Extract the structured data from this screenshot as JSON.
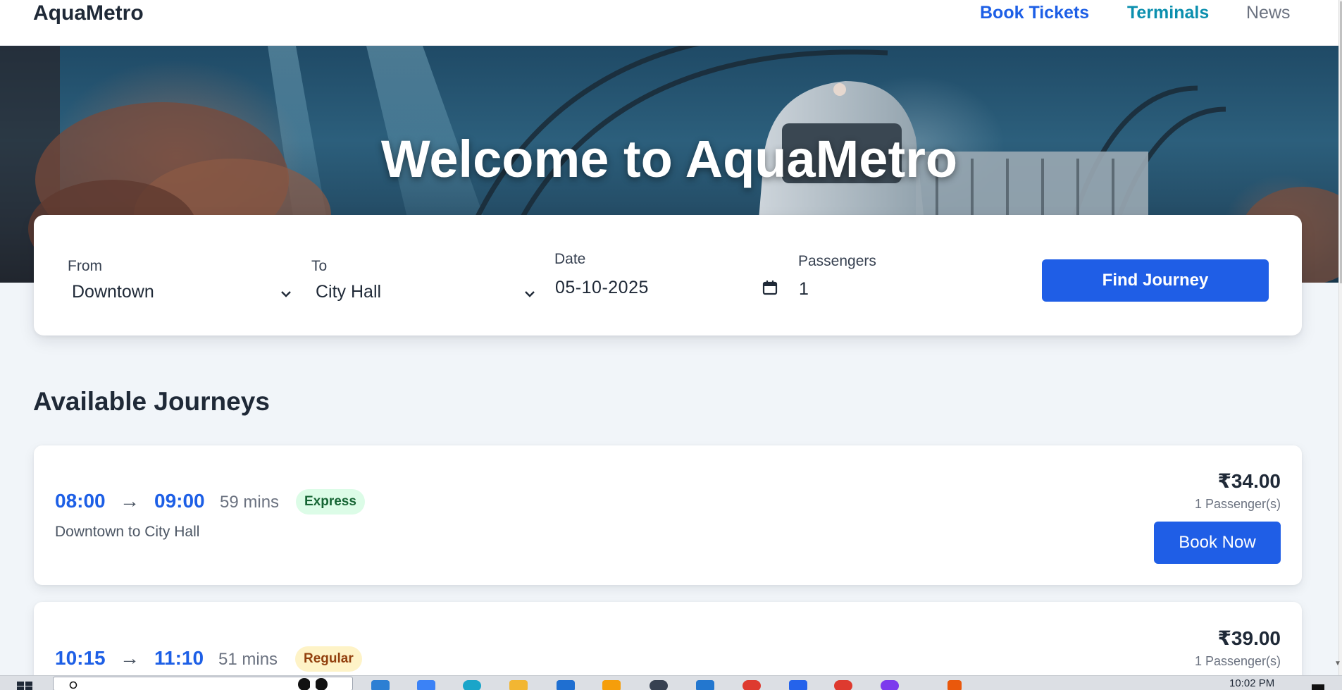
{
  "header": {
    "brand": "AquaMetro",
    "nav": [
      {
        "label": "Book Tickets"
      },
      {
        "label": "Terminals"
      },
      {
        "label": "News"
      }
    ]
  },
  "hero": {
    "title": "Welcome to AquaMetro"
  },
  "search": {
    "from": {
      "label": "From",
      "value": "Downtown"
    },
    "to": {
      "label": "To",
      "value": "City Hall"
    },
    "date": {
      "label": "Date",
      "value": "05-10-2025"
    },
    "passengers": {
      "label": "Passengers",
      "value": "1"
    },
    "submit_label": "Find Journey"
  },
  "journeys_section": {
    "title": "Available Journeys",
    "items": [
      {
        "depart": "08:00",
        "arrow": "→",
        "arrive": "09:00",
        "duration": "59 mins",
        "type": "Express",
        "route": "Downtown to City Hall",
        "price": "₹34.00",
        "passengers": "1 Passenger(s)",
        "book_label": "Book Now"
      },
      {
        "depart": "10:15",
        "arrow": "→",
        "arrive": "11:10",
        "duration": "51 mins",
        "type": "Regular",
        "price": "₹39.00",
        "passengers": "1 Passenger(s)"
      }
    ]
  },
  "taskbar": {
    "clock": "10:02 PM",
    "icons": [
      "windows-start-icon",
      "search-icon",
      "task-view-icon",
      "mail-icon",
      "copilot-icon",
      "edge-icon",
      "file-explorer-icon",
      "store-icon",
      "folder-icon",
      "chatgpt-icon",
      "vscode-icon",
      "chrome-icon",
      "intel-icon",
      "chrome-profile-icon",
      "podcast-icon",
      "notification-icon"
    ],
    "colors": {
      "edge": "#1aa5c9",
      "explorer": "#f2b632",
      "store": "#1f6fd1",
      "vscode": "#2377cf",
      "chrome": "#de3a2f",
      "podcast": "#7c3aed"
    }
  },
  "theme": {
    "accent": "#1f5ee6",
    "teal": "#0b8fae",
    "background": "#f1f5f9",
    "express_bg": "#dcfce7",
    "regular_bg": "#fef3c7"
  }
}
